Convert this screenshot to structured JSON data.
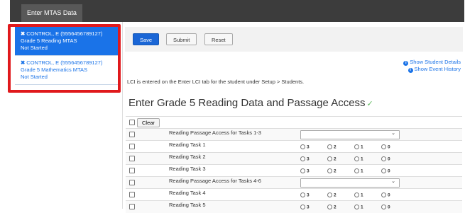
{
  "header": {
    "tab_label": "Enter MTAS Data"
  },
  "students": [
    {
      "name": "CONTROL, E (5556456789127)",
      "test": "Grade 5 Reading MTAS",
      "status": "Not Started",
      "active": true
    },
    {
      "name": "CONTROL, E (5556456789127)",
      "test": "Grade 5 Mathematics MTAS",
      "status": "Not Started",
      "active": false
    }
  ],
  "toolbar": {
    "save_label": "Save",
    "submit_label": "Submit",
    "reset_label": "Reset"
  },
  "links": {
    "show_student_details": "Show Student Details",
    "show_event_history": "Show Event History"
  },
  "note": "LCI is entered on the Enter LCI tab for the student under Setup > Students.",
  "heading": "Enter Grade 5 Reading Data and Passage Access",
  "clear_label": "Clear",
  "rows": [
    {
      "label": "Reading Passage Access for Tasks 1-3",
      "kind": "select"
    },
    {
      "label": "Reading Task 1",
      "kind": "radio"
    },
    {
      "label": "Reading Task 2",
      "kind": "radio"
    },
    {
      "label": "Reading Task 3",
      "kind": "radio"
    },
    {
      "label": "Reading Passage Access for Tasks 4-6",
      "kind": "select"
    },
    {
      "label": "Reading Task 4",
      "kind": "radio"
    },
    {
      "label": "Reading Task 5",
      "kind": "radio"
    }
  ],
  "score_options": [
    "3",
    "2",
    "1",
    "0"
  ],
  "colors": {
    "accent": "#1a73e8",
    "highlight": "#e0191c",
    "topbar": "#3c3c3c",
    "check": "#5cb85c"
  }
}
